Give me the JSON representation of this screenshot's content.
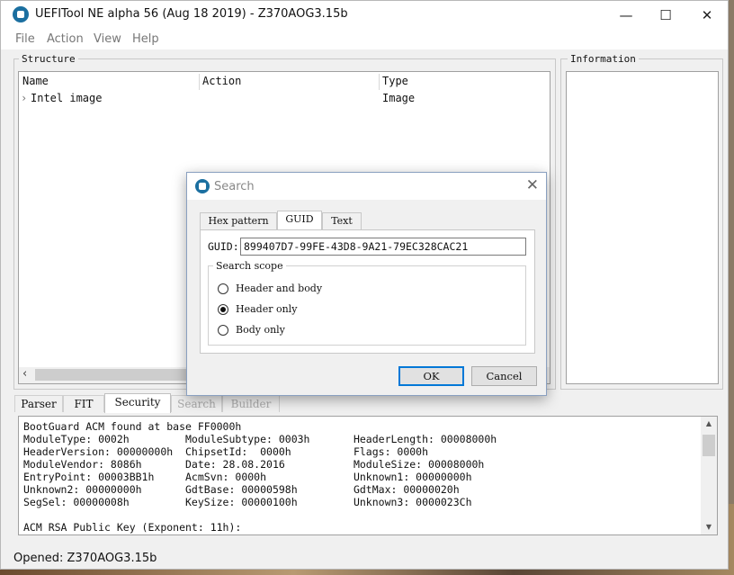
{
  "window": {
    "title": "UEFITool NE alpha 56 (Aug 18 2019) - Z370AOG3.15b",
    "minimize": "—",
    "maximize": "☐",
    "close": "✕"
  },
  "menu": [
    "File",
    "Action",
    "View",
    "Help"
  ],
  "structure": {
    "label": "Structure",
    "columns": [
      "Name",
      "Action",
      "Type"
    ],
    "rows": [
      {
        "expander": "›",
        "name": "Intel image",
        "action": "",
        "type": "Image"
      }
    ],
    "scroll_left": "‹"
  },
  "information": {
    "label": "Information"
  },
  "bottom_tabs": [
    {
      "label": "Parser"
    },
    {
      "label": "FIT"
    },
    {
      "label": "Security"
    },
    {
      "label": "Search"
    },
    {
      "label": "Builder"
    }
  ],
  "log_lines": [
    "BootGuard ACM found at base FF0000h",
    "ModuleType: 0002h         ModuleSubtype: 0003h       HeaderLength: 00008000h",
    "HeaderVersion: 00000000h  ChipsetId:  0000h          Flags: 0000h",
    "ModuleVendor: 8086h       Date: 28.08.2016           ModuleSize: 00008000h",
    "EntryPoint: 00003BB1h     AcmSvn: 0000h              Unknown1: 00000000h",
    "Unknown2: 00000000h       GdtBase: 00000598h         GdtMax: 00000020h",
    "SegSel: 00000008h         KeySize: 00000100h         Unknown3: 0000023Ch",
    "",
    "ACM RSA Public Key (Exponent: 11h):"
  ],
  "status": "Opened: Z370AOG3.15b",
  "dialog": {
    "title": "Search",
    "close": "✕",
    "tabs": [
      "Hex pattern",
      "GUID",
      "Text"
    ],
    "guid_label": "GUID:",
    "guid_value": "899407D7-99FE-43D8-9A21-79EC328CAC21",
    "scope_label": "Search scope",
    "options": [
      "Header and body",
      "Header only",
      "Body only"
    ],
    "selected_option": "Header only",
    "ok": "OK",
    "cancel": "Cancel"
  }
}
